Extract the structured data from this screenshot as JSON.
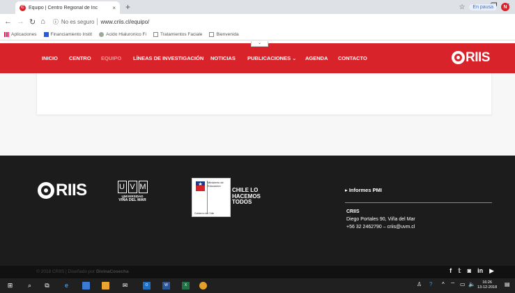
{
  "browser": {
    "tab_title": "Equipo | Centro Regional de Inc",
    "tab_close": "×",
    "new_tab": "+",
    "window_controls": {
      "minimize": "–",
      "maximize": "❐",
      "close": "×"
    },
    "insecure_label": "No es seguro",
    "url": "www.criis.cl/equipo/",
    "star": "☆",
    "pause_label": "En pausa",
    "avatar_letter": "N",
    "bookmarks": [
      {
        "label": "Aplicaciones",
        "icon": "apps-grid-icon",
        "color": "#d14"
      },
      {
        "label": "Financiamiento Instit",
        "icon": "bookmark-folder-icon",
        "color": "#2a5bd7"
      },
      {
        "label": "Acido Hialuronico Fi",
        "icon": "site-favicon-icon",
        "color": "#9a9"
      },
      {
        "label": "Tratamientos Faciale",
        "icon": "page-icon",
        "color": "#888"
      },
      {
        "label": "Bienvenida",
        "icon": "page-icon",
        "color": "#888"
      }
    ]
  },
  "nav": {
    "items": [
      {
        "label": "INICIO",
        "active": false
      },
      {
        "label": "CENTRO",
        "active": false
      },
      {
        "label": "EQUIPO",
        "active": true
      },
      {
        "label": "LÍNEAS DE INVESTIGACIÓN",
        "active": false
      },
      {
        "label": "NOTICIAS",
        "active": false
      },
      {
        "label": "PUBLICACIONES ⌄",
        "active": false
      },
      {
        "label": "AGENDA",
        "active": false
      },
      {
        "label": "CONTACTO",
        "active": false
      }
    ],
    "logo": "RIIS",
    "caret": "⌄",
    "bg_color": "#d8232a"
  },
  "footer": {
    "logo": "RIIS",
    "uvm": {
      "letters": [
        "U",
        "V",
        "M"
      ],
      "sub": "UNIVERSIDAD",
      "sub2": "VIÑA DEL MAR"
    },
    "gov": {
      "ministry": "Ministerio de Educación",
      "bottom": "Gobierno de Chile"
    },
    "chile_slogan": [
      "CHILE LO",
      "HACEMOS",
      "TODOS"
    ],
    "informes": "▸ Informes PMI",
    "org_name": "CRIIS",
    "address": "Diego Portales 90, Viña del Mar",
    "contact": "+56 32 2462790 – criis@uvm.cl",
    "copyright": "© 2018 CRIIS | Diseñado por",
    "designer": "DivinaCosecha",
    "social": [
      "f",
      "𝕥",
      "◙",
      "in",
      "▶"
    ]
  },
  "taskbar": {
    "clock_time": "16:26",
    "clock_date": "13-12-2018"
  }
}
